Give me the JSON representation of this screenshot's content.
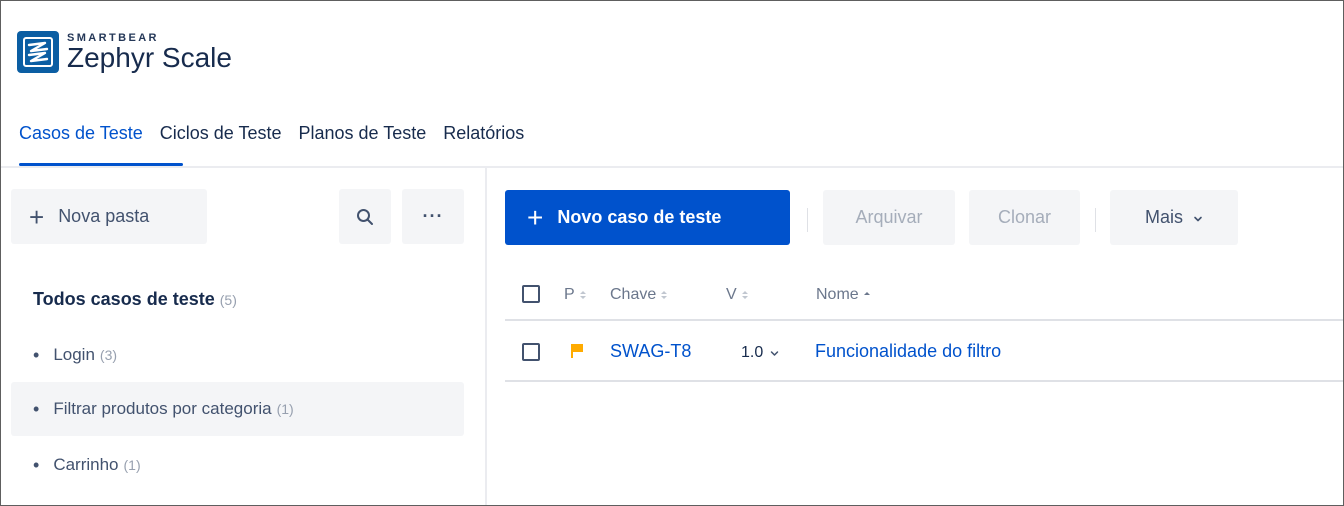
{
  "header": {
    "brand": "SMARTBEAR",
    "product": "Zephyr Scale"
  },
  "tabs": [
    {
      "label": "Casos de Teste",
      "active": true
    },
    {
      "label": "Ciclos de Teste",
      "active": false
    },
    {
      "label": "Planos de Teste",
      "active": false
    },
    {
      "label": "Relatórios",
      "active": false
    }
  ],
  "sidebar": {
    "new_folder_label": "Nova pasta",
    "more_label": "···",
    "root": {
      "label": "Todos casos de teste",
      "count": "(5)"
    },
    "items": [
      {
        "label": "Login",
        "count": "(3)",
        "selected": false
      },
      {
        "label": "Filtrar produtos por categoria",
        "count": "(1)",
        "selected": true
      },
      {
        "label": "Carrinho",
        "count": "(1)",
        "selected": false
      }
    ]
  },
  "toolbar": {
    "new_test_case_label": "Novo caso de teste",
    "archive_label": "Arquivar",
    "clone_label": "Clonar",
    "more_label": "Mais"
  },
  "table": {
    "columns": [
      "P",
      "Chave",
      "V",
      "Nome"
    ],
    "rows": [
      {
        "priority_color": "#ffab00",
        "key": "SWAG-T8",
        "version": "1.0",
        "name": "Funcionalidade do filtro"
      }
    ]
  },
  "colors": {
    "accent": "#0052cc",
    "logo": "#0b5ea3",
    "priority_medium": "#ffab00"
  }
}
